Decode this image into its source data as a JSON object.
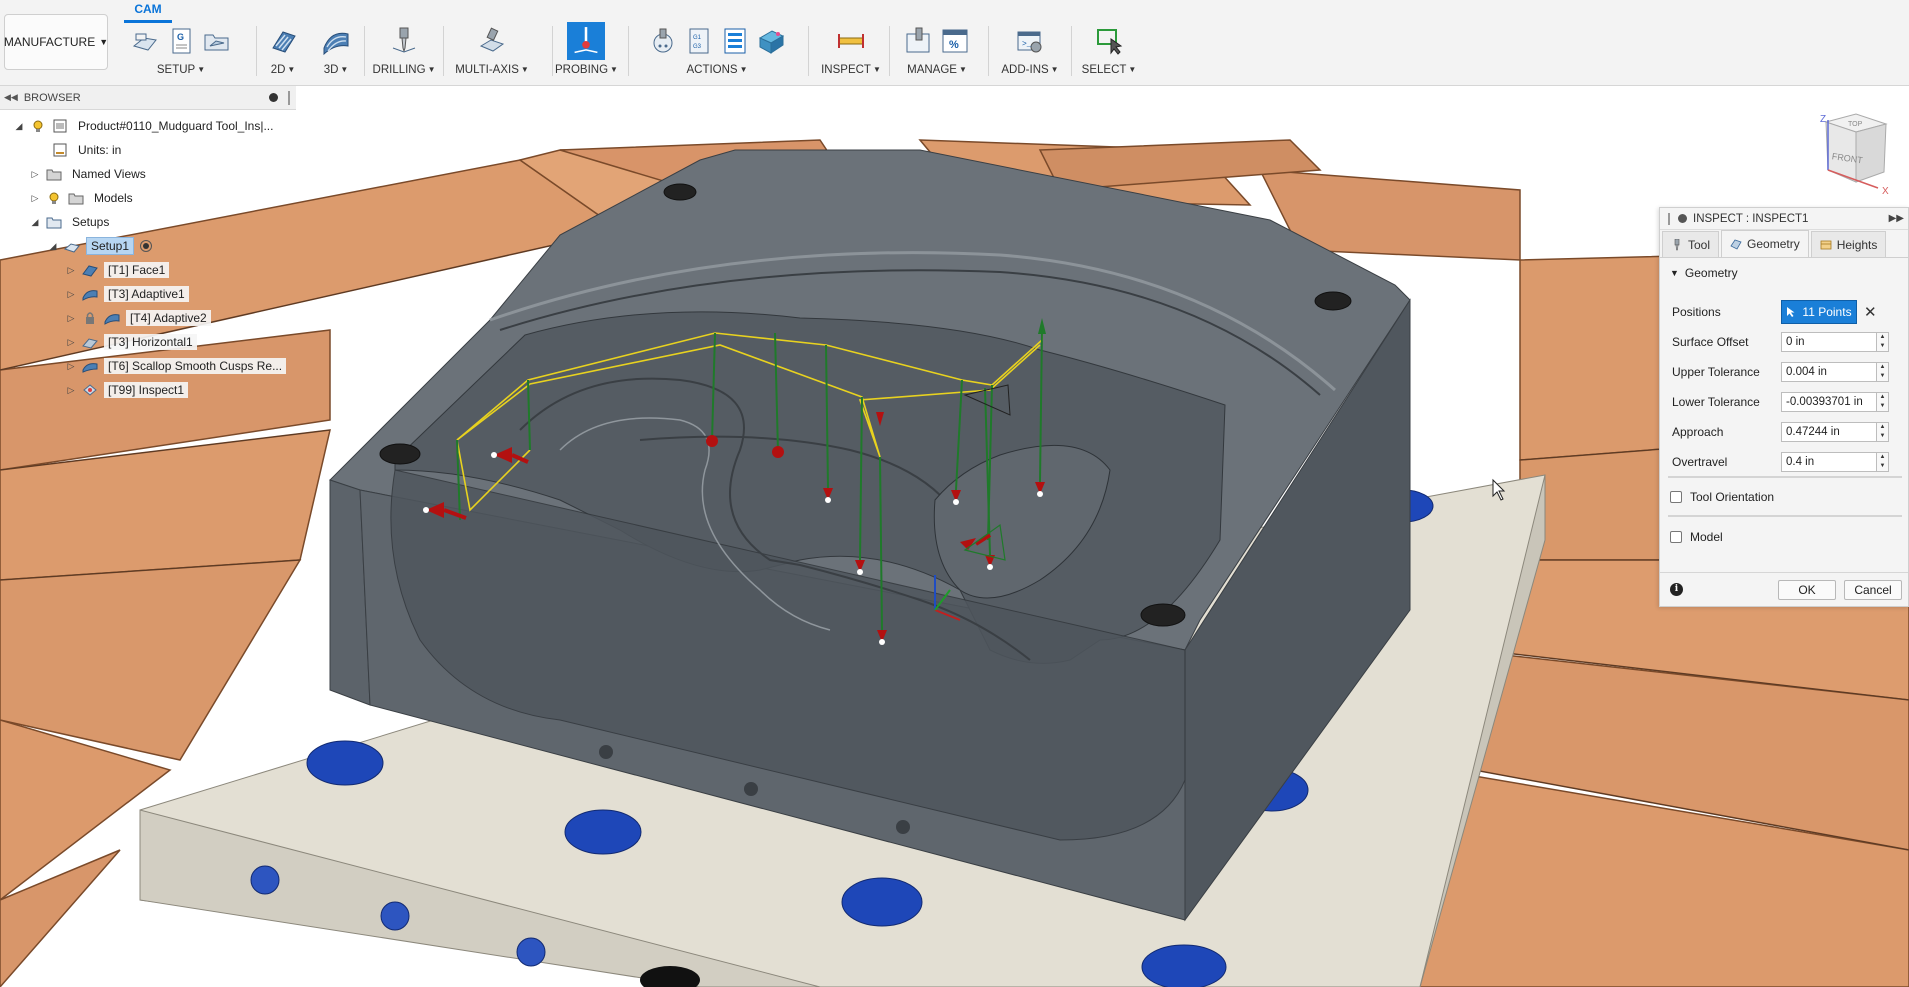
{
  "toolbar": {
    "active_tab": "CAM",
    "workspace_label": "MANUFACTURE",
    "groups": [
      {
        "label": "SETUP"
      },
      {
        "label": "2D"
      },
      {
        "label": "3D"
      },
      {
        "label": "DRILLING"
      },
      {
        "label": "MULTI-AXIS"
      },
      {
        "label": "PROBING"
      },
      {
        "label": "ACTIONS"
      },
      {
        "label": "INSPECT"
      },
      {
        "label": "MANAGE"
      },
      {
        "label": "ADD-INS"
      },
      {
        "label": "SELECT"
      }
    ]
  },
  "browser": {
    "title": "BROWSER",
    "items": [
      {
        "label": "Product#0110_Mudguard Tool_Ins|..."
      },
      {
        "label": "Units: in"
      },
      {
        "label": "Named Views"
      },
      {
        "label": "Models"
      },
      {
        "label": "Setups"
      },
      {
        "label": "Setup1"
      },
      {
        "label": "[T1] Face1"
      },
      {
        "label": "[T3] Adaptive1"
      },
      {
        "label": "[T4] Adaptive2"
      },
      {
        "label": "[T3] Horizontal1"
      },
      {
        "label": "[T6] Scallop Smooth Cusps Re..."
      },
      {
        "label": "[T99] Inspect1"
      }
    ]
  },
  "inspect_panel": {
    "title": "INSPECT : INSPECT1",
    "tabs": [
      {
        "label": "Tool"
      },
      {
        "label": "Geometry"
      },
      {
        "label": "Heights"
      }
    ],
    "active_tab": "Geometry",
    "section": "Geometry",
    "positions": {
      "label": "Positions",
      "value": "11 Points"
    },
    "fields": [
      {
        "label": "Surface Offset",
        "value": "0 in"
      },
      {
        "label": "Upper Tolerance",
        "value": "0.004 in"
      },
      {
        "label": "Lower Tolerance",
        "value": "-0.00393701 in"
      },
      {
        "label": "Approach",
        "value": "0.47244 in"
      },
      {
        "label": "Overtravel",
        "value": "0.4 in"
      }
    ],
    "checkboxes": [
      {
        "label": "Tool Orientation",
        "checked": false
      },
      {
        "label": "Model",
        "checked": false
      }
    ],
    "ok_label": "OK",
    "cancel_label": "Cancel"
  },
  "viewcube": {
    "top": "TOP",
    "front": "FRONT",
    "z_axis": "Z",
    "x_axis": "X"
  },
  "colors": {
    "accent": "#1a7fd8",
    "part": "#646b72",
    "fixture": "#e3dfd3",
    "table": "#dc9a6c",
    "path": "#e8d21f",
    "probe_line": "#1f7a2a",
    "probe_arrow": "#b31010"
  }
}
